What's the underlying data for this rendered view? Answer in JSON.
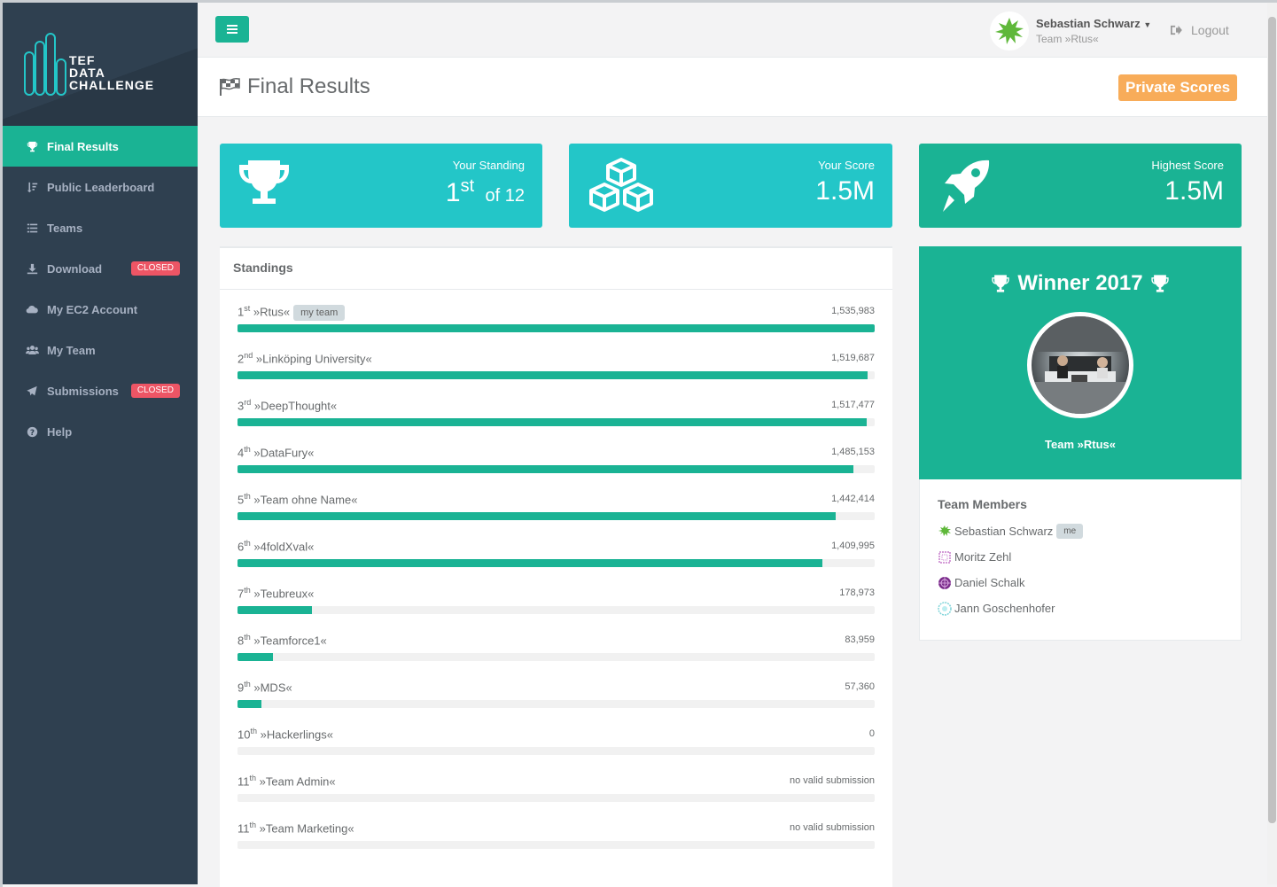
{
  "app": {
    "logo_lines": [
      "TEF",
      "DATA",
      "CHALLENGE"
    ]
  },
  "sidebar": {
    "items": [
      {
        "label": "Final Results",
        "icon": "trophy-icon",
        "active": true
      },
      {
        "label": "Public Leaderboard",
        "icon": "sort-icon"
      },
      {
        "label": "Teams",
        "icon": "list-icon"
      },
      {
        "label": "Download",
        "icon": "download-icon",
        "badge": "CLOSED"
      },
      {
        "label": "My EC2 Account",
        "icon": "cloud-icon"
      },
      {
        "label": "My Team",
        "icon": "users-icon"
      },
      {
        "label": "Submissions",
        "icon": "paper-plane-icon",
        "badge": "CLOSED"
      },
      {
        "label": "Help",
        "icon": "question-icon"
      }
    ]
  },
  "topbar": {
    "user_name": "Sebastian Schwarz",
    "user_team": "Team »Rtus«",
    "logout_label": "Logout"
  },
  "heading": {
    "title": "Final Results",
    "private_scores_label": "Private Scores"
  },
  "widgets": {
    "standing": {
      "label": "Your Standing",
      "rank": "1",
      "suffix": "st",
      "of": "of 12"
    },
    "score": {
      "label": "Your Score",
      "value": "1.5M"
    },
    "highest": {
      "label": "Highest Score",
      "value": "1.5M"
    }
  },
  "standings": {
    "title": "Standings",
    "my_team_badge": "my team",
    "rows": [
      {
        "rank": "1",
        "suffix": "st",
        "team": "»Rtus«",
        "score": "1,535,983",
        "fraction": 1.0,
        "my_team": true
      },
      {
        "rank": "2",
        "suffix": "nd",
        "team": "»Linköping University«",
        "score": "1,519,687",
        "fraction": 0.989
      },
      {
        "rank": "3",
        "suffix": "rd",
        "team": "»DeepThought«",
        "score": "1,517,477",
        "fraction": 0.988
      },
      {
        "rank": "4",
        "suffix": "th",
        "team": "»DataFury«",
        "score": "1,485,153",
        "fraction": 0.967
      },
      {
        "rank": "5",
        "suffix": "th",
        "team": "»Team ohne Name«",
        "score": "1,442,414",
        "fraction": 0.939
      },
      {
        "rank": "6",
        "suffix": "th",
        "team": "»4foldXval«",
        "score": "1,409,995",
        "fraction": 0.918
      },
      {
        "rank": "7",
        "suffix": "th",
        "team": "»Teubreux«",
        "score": "178,973",
        "fraction": 0.117
      },
      {
        "rank": "8",
        "suffix": "th",
        "team": "»Teamforce1«",
        "score": "83,959",
        "fraction": 0.055
      },
      {
        "rank": "9",
        "suffix": "th",
        "team": "»MDS«",
        "score": "57,360",
        "fraction": 0.037
      },
      {
        "rank": "10",
        "suffix": "th",
        "team": "»Hackerlings«",
        "score": "0",
        "fraction": 0
      },
      {
        "rank": "11",
        "suffix": "th",
        "team": "»Team Admin«",
        "score": "no valid submission",
        "fraction": 0
      },
      {
        "rank": "11",
        "suffix": "th",
        "team": "»Team Marketing«",
        "score": "no valid submission",
        "fraction": 0
      }
    ]
  },
  "winner": {
    "title": "Winner 2017",
    "team": "Team »Rtus«"
  },
  "members": {
    "title": "Team Members",
    "me_badge": "me",
    "list": [
      {
        "name": "Sebastian Schwarz",
        "me": true,
        "color": "#5fb83a"
      },
      {
        "name": "Moritz Zehl",
        "color": "#c77dcc"
      },
      {
        "name": "Daniel Schalk",
        "color": "#7b2d8b"
      },
      {
        "name": "Jann Goschenhofer",
        "color": "#7fd4d9"
      }
    ]
  },
  "colors": {
    "accent": "#1ab394",
    "cyan": "#23c6c8",
    "sidebar": "#2f4050",
    "warning": "#f8ac59",
    "danger": "#ed5565"
  }
}
